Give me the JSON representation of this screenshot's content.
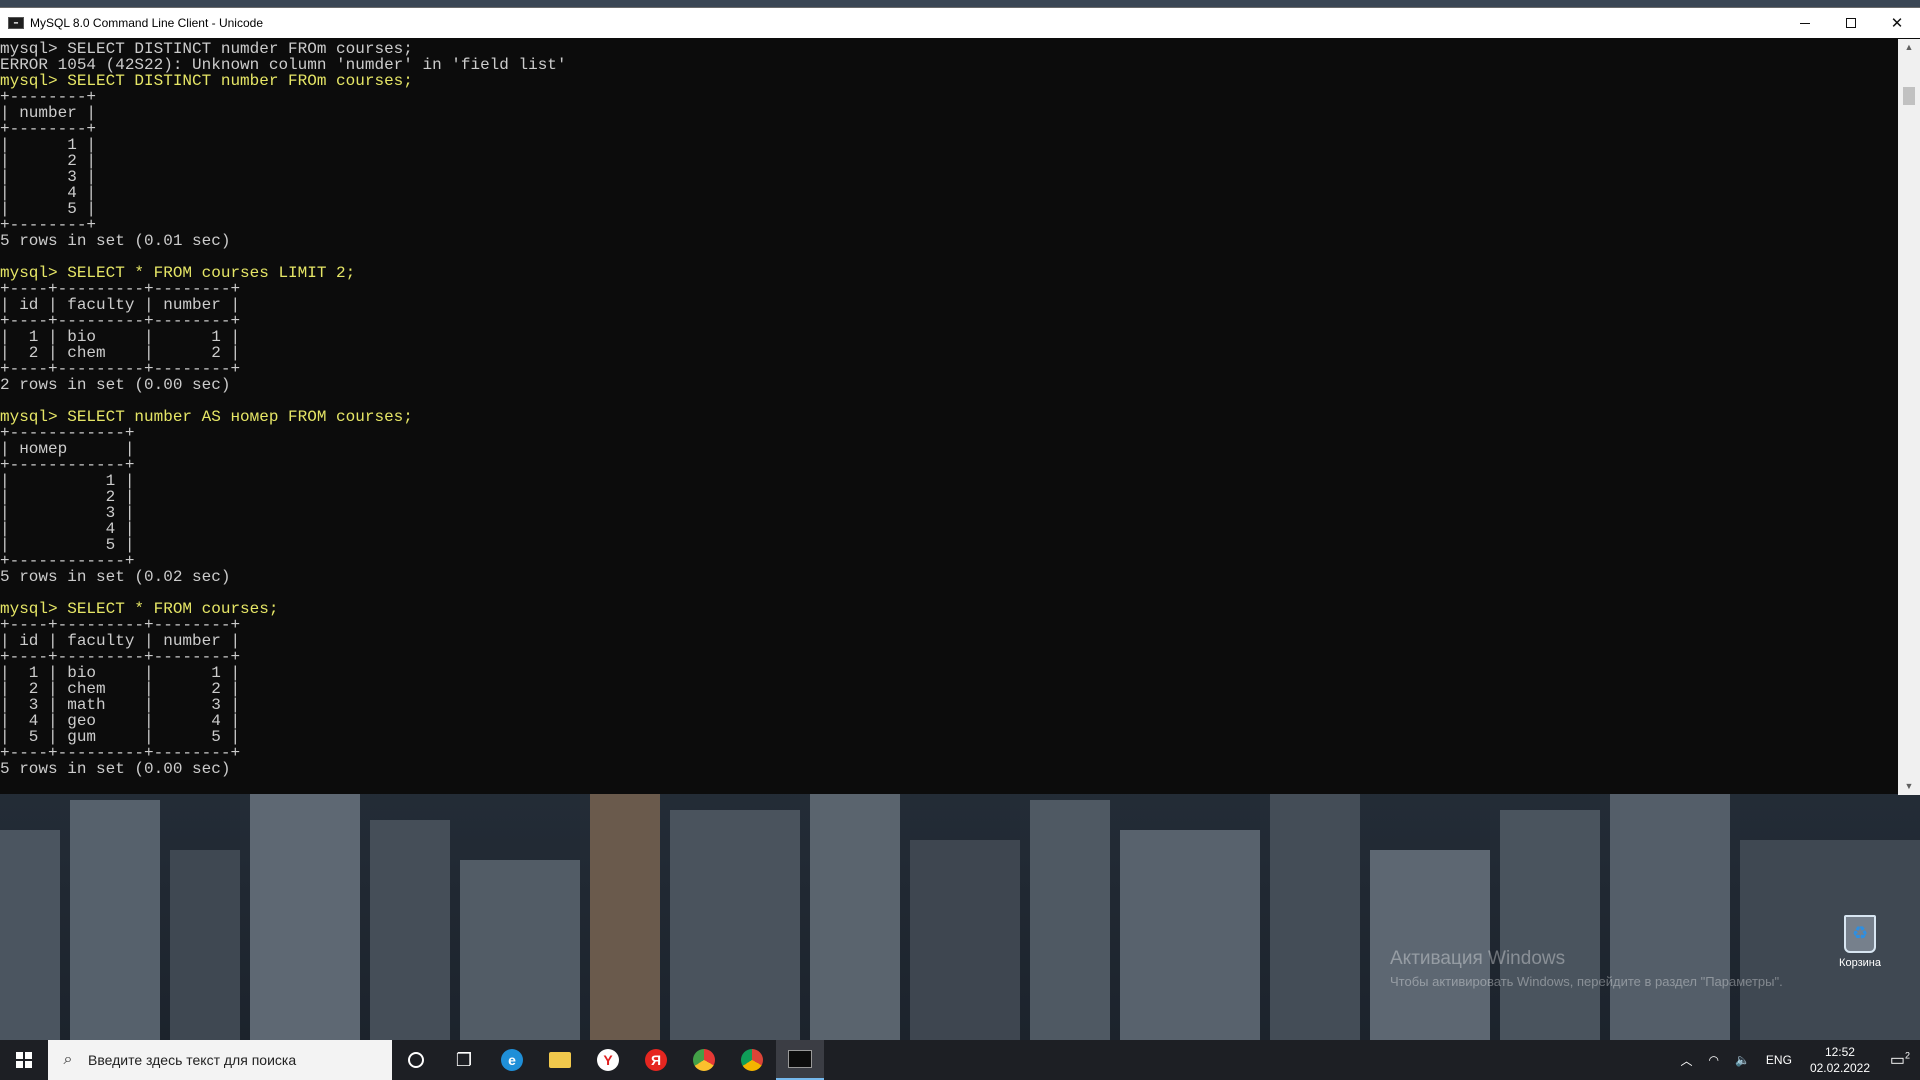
{
  "window": {
    "title": "MySQL 8.0 Command Line Client - Unicode",
    "icon_label": "MySQL",
    "controls": {
      "minimize": "minimize-icon",
      "maximize": "maximize-icon",
      "close": "✕"
    }
  },
  "console_lines": [
    {
      "t": "mysql> SELECT DISTINCT numder FROm courses;",
      "cmd": false
    },
    {
      "t": "ERROR 1054 (42S22): Unknown column 'numder' in 'field list'",
      "cmd": false
    },
    {
      "t": "mysql> SELECT DISTINCT number FROm courses;",
      "cmd": true
    },
    {
      "t": "+--------+",
      "cmd": false
    },
    {
      "t": "| number |",
      "cmd": false
    },
    {
      "t": "+--------+",
      "cmd": false
    },
    {
      "t": "|      1 |",
      "cmd": false
    },
    {
      "t": "|      2 |",
      "cmd": false
    },
    {
      "t": "|      3 |",
      "cmd": false
    },
    {
      "t": "|      4 |",
      "cmd": false
    },
    {
      "t": "|      5 |",
      "cmd": false
    },
    {
      "t": "+--------+",
      "cmd": false
    },
    {
      "t": "5 rows in set (0.01 sec)",
      "cmd": false
    },
    {
      "t": "",
      "cmd": false
    },
    {
      "t": "mysql> SELECT * FROM courses LIMIT 2;",
      "cmd": true
    },
    {
      "t": "+----+---------+--------+",
      "cmd": false
    },
    {
      "t": "| id | faculty | number |",
      "cmd": false
    },
    {
      "t": "+----+---------+--------+",
      "cmd": false
    },
    {
      "t": "|  1 | bio     |      1 |",
      "cmd": false
    },
    {
      "t": "|  2 | chem    |      2 |",
      "cmd": false
    },
    {
      "t": "+----+---------+--------+",
      "cmd": false
    },
    {
      "t": "2 rows in set (0.00 sec)",
      "cmd": false
    },
    {
      "t": "",
      "cmd": false
    },
    {
      "t": "mysql> SELECT number AS номер FROM courses;",
      "cmd": true
    },
    {
      "t": "+------------+",
      "cmd": false
    },
    {
      "t": "| номер      |",
      "cmd": false
    },
    {
      "t": "+------------+",
      "cmd": false
    },
    {
      "t": "|          1 |",
      "cmd": false
    },
    {
      "t": "|          2 |",
      "cmd": false
    },
    {
      "t": "|          3 |",
      "cmd": false
    },
    {
      "t": "|          4 |",
      "cmd": false
    },
    {
      "t": "|          5 |",
      "cmd": false
    },
    {
      "t": "+------------+",
      "cmd": false
    },
    {
      "t": "5 rows in set (0.02 sec)",
      "cmd": false
    },
    {
      "t": "",
      "cmd": false
    },
    {
      "t": "mysql> SELECT * FROM courses;",
      "cmd": true
    },
    {
      "t": "+----+---------+--------+",
      "cmd": false
    },
    {
      "t": "| id | faculty | number |",
      "cmd": false
    },
    {
      "t": "+----+---------+--------+",
      "cmd": false
    },
    {
      "t": "|  1 | bio     |      1 |",
      "cmd": false
    },
    {
      "t": "|  2 | chem    |      2 |",
      "cmd": false
    },
    {
      "t": "|  3 | math    |      3 |",
      "cmd": false
    },
    {
      "t": "|  4 | geo     |      4 |",
      "cmd": false
    },
    {
      "t": "|  5 | gum     |      5 |",
      "cmd": false
    },
    {
      "t": "+----+---------+--------+",
      "cmd": false
    },
    {
      "t": "5 rows in set (0.00 sec)",
      "cmd": false
    }
  ],
  "desktop": {
    "watermark_title": "Активация Windows",
    "watermark_sub": "Чтобы активировать Windows, перейдите в раздел \"Параметры\".",
    "recycle_bin_label": "Корзина"
  },
  "taskbar": {
    "search_placeholder": "Введите здесь текст для поиска",
    "apps": [
      "cortana-icon",
      "task-view-icon",
      "edge-icon",
      "file-explorer-icon",
      "yandex-browser-icon",
      "yandex-icon",
      "chromium-icon",
      "chrome-icon",
      "mysql-console-icon"
    ],
    "tray_language": "ENG",
    "time": "12:52",
    "date": "02.02.2022",
    "notification_count": "2"
  },
  "colors": {
    "console_bg": "#0c0c0c",
    "console_text": "#cccccc",
    "command_text": "#e6e666",
    "taskbar_bg": "#1d1f24"
  }
}
